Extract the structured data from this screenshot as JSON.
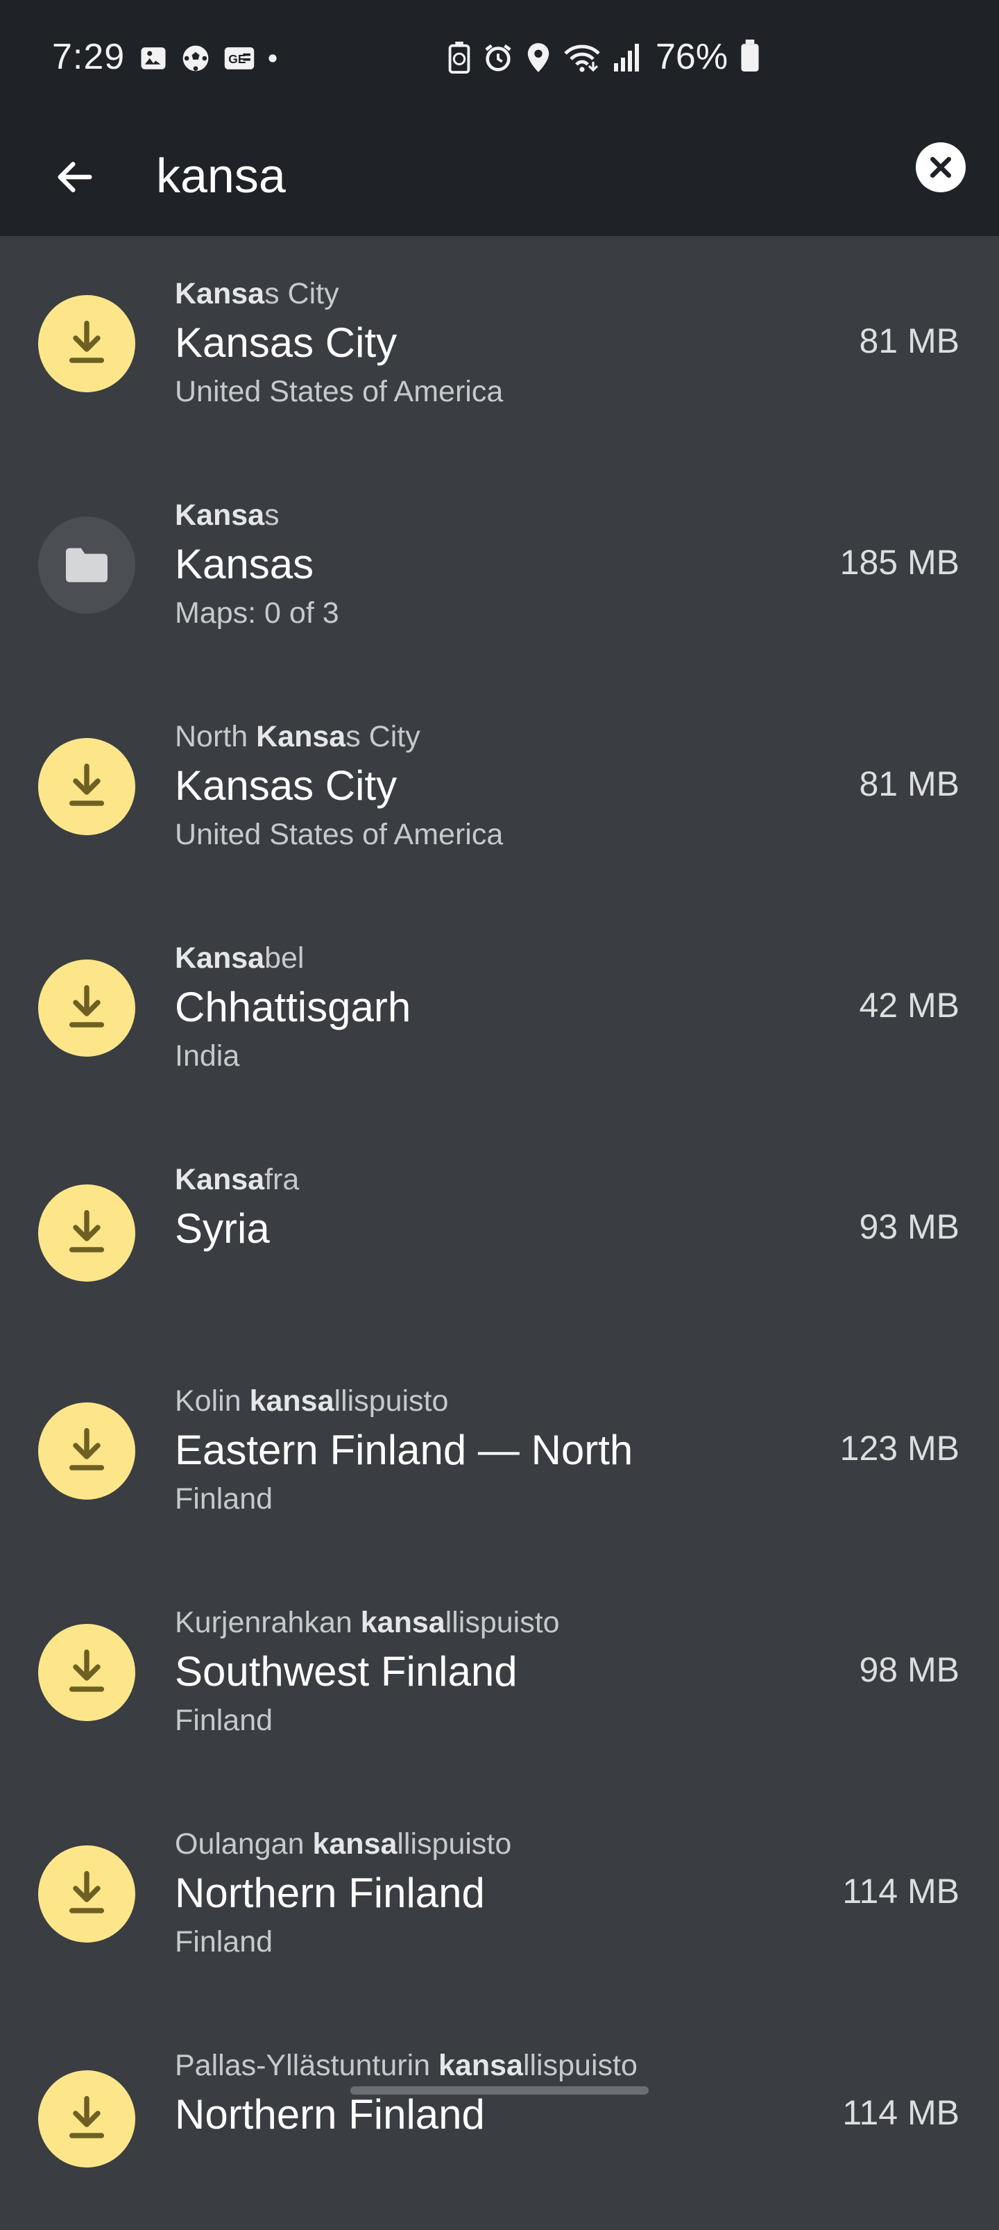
{
  "status_bar": {
    "time": "7:29",
    "battery": "76%",
    "left_icons": [
      "gallery-icon",
      "soccer-ball-icon",
      "news-card-icon",
      "dot-icon"
    ],
    "right_icons": [
      "battery-saver-icon",
      "alarm-icon",
      "location-icon",
      "wifi-icon",
      "signal-icon"
    ]
  },
  "search": {
    "query": "kansa",
    "back_icon": "arrow-left-icon",
    "clear_icon": "close-circle-icon"
  },
  "colors": {
    "background": "#3a3d41",
    "header": "#1f2226",
    "download_accent": "#fde68a",
    "folder_bg": "#4b4e52"
  },
  "results": [
    {
      "icon": "download-icon",
      "match_before": "",
      "match_bold": "Kansa",
      "match_after": "s City",
      "title": "Kansas City",
      "subtitle": "United States of America",
      "size": "81 MB"
    },
    {
      "icon": "folder-icon",
      "match_before": "",
      "match_bold": "Kansa",
      "match_after": "s",
      "title": "Kansas",
      "subtitle": "Maps: 0 of 3",
      "size": "185 MB"
    },
    {
      "icon": "download-icon",
      "match_before": "North ",
      "match_bold": "Kansa",
      "match_after": "s City",
      "title": "Kansas City",
      "subtitle": "United States of America",
      "size": "81 MB"
    },
    {
      "icon": "download-icon",
      "match_before": "",
      "match_bold": "Kansa",
      "match_after": "bel",
      "title": "Chhattisgarh",
      "subtitle": "India",
      "size": "42 MB"
    },
    {
      "icon": "download-icon",
      "match_before": "",
      "match_bold": "Kansa",
      "match_after": "fra",
      "title": "Syria",
      "subtitle": "",
      "size": "93 MB"
    },
    {
      "icon": "download-icon",
      "match_before": "Kolin ",
      "match_bold": "kansa",
      "match_after": "llispuisto",
      "title": "Eastern Finland — North",
      "subtitle": "Finland",
      "size": "123 MB"
    },
    {
      "icon": "download-icon",
      "match_before": "Kurjenrahkan ",
      "match_bold": "kansa",
      "match_after": "llispuisto",
      "title": "Southwest Finland",
      "subtitle": "Finland",
      "size": "98 MB"
    },
    {
      "icon": "download-icon",
      "match_before": "Oulangan ",
      "match_bold": "kansa",
      "match_after": "llispuisto",
      "title": "Northern Finland",
      "subtitle": "Finland",
      "size": "114 MB"
    },
    {
      "icon": "download-icon",
      "match_before": "Pallas-Yllästunturin ",
      "match_bold": "kansa",
      "match_after": "llispuisto",
      "title": "Northern Finland",
      "subtitle": "",
      "size": "114 MB"
    }
  ]
}
